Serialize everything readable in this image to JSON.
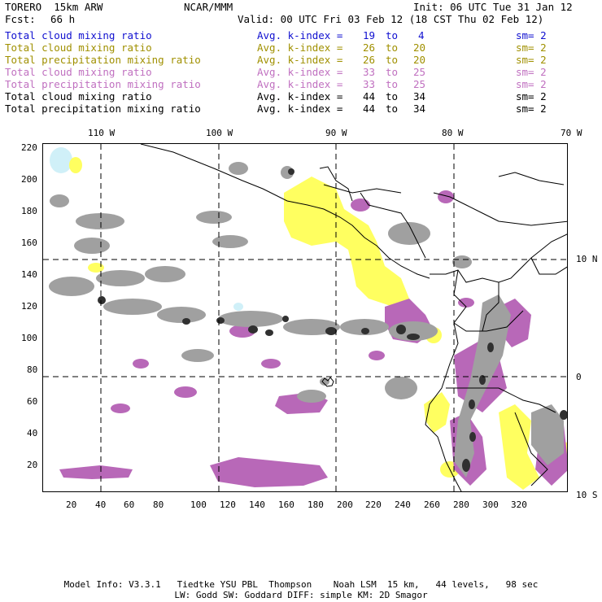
{
  "header": {
    "model": "TORERO  15km ARW",
    "center": "NCAR/MMM",
    "init": "Init: 06 UTC Tue 31 Jan 12",
    "fcst_label": "Fcst:",
    "fcst_value": "66 h",
    "valid": "Valid: 00 UTC Fri 03 Feb 12 (18 CST Thu 02 Feb 12)"
  },
  "legend": [
    {
      "field": "Total cloud mixing ratio",
      "avg": "Avg. k-index =",
      "k1": "19",
      "to": "to",
      "k2": "4",
      "sm": "sm= 2",
      "color": "#1010d0"
    },
    {
      "field": "Total cloud mixing ratio",
      "avg": "Avg. k-index =",
      "k1": "26",
      "to": "to",
      "k2": "20",
      "sm": "sm= 2",
      "color": "#a09000"
    },
    {
      "field": "Total precipitation mixing ratio",
      "avg": "Avg. k-index =",
      "k1": "26",
      "to": "to",
      "k2": "20",
      "sm": "sm= 2",
      "color": "#a09000"
    },
    {
      "field": "Total cloud mixing ratio",
      "avg": "Avg. k-index =",
      "k1": "33",
      "to": "to",
      "k2": "25",
      "sm": "sm= 2",
      "color": "#c070c0"
    },
    {
      "field": "Total precipitation mixing ratio",
      "avg": "Avg. k-index =",
      "k1": "33",
      "to": "to",
      "k2": "25",
      "sm": "sm= 2",
      "color": "#c070c0"
    },
    {
      "field": "Total cloud mixing ratio",
      "avg": "Avg. k-index =",
      "k1": "44",
      "to": "to",
      "k2": "34",
      "sm": "sm= 2",
      "color": "#000000"
    },
    {
      "field": "Total precipitation mixing ratio",
      "avg": "Avg. k-index =",
      "k1": "44",
      "to": "to",
      "k2": "34",
      "sm": "sm= 2",
      "color": "#000000"
    }
  ],
  "map": {
    "lon_labels": [
      "110 W",
      "100 W",
      "90 W",
      "80 W",
      "70 W"
    ],
    "lat_labels": [
      "10 N",
      "0",
      "10 S"
    ],
    "y_ticks": [
      "220",
      "200",
      "180",
      "160",
      "140",
      "120",
      "100",
      "80",
      "60",
      "40",
      "20"
    ],
    "x_ticks": [
      "20",
      "40",
      "60",
      "80",
      "100",
      "120",
      "140",
      "160",
      "180",
      "200",
      "220",
      "240",
      "260",
      "280",
      "300",
      "320"
    ],
    "colors": {
      "cloud_low": "#d0f0f8",
      "mid": "#ffff60",
      "purple": "#b868b8",
      "gray": "#a0a0a0",
      "dark": "#303030"
    }
  },
  "footer": {
    "line1": "Model Info: V3.3.1   Tiedtke YSU PBL  Thompson    Noah LSM  15 km,   44 levels,   98 sec",
    "line2": "LW: Godd SW: Goddard DIFF: simple KM: 2D Smagor"
  }
}
